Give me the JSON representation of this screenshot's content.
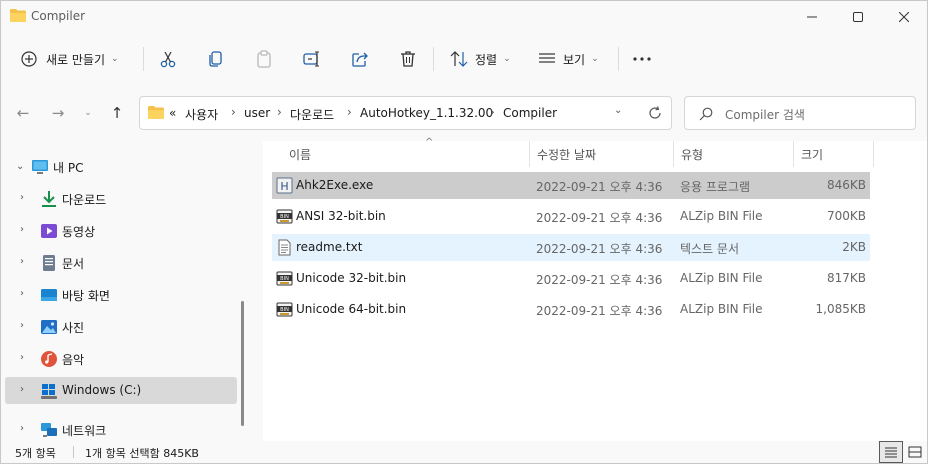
{
  "window": {
    "title": "Compiler",
    "controls": [
      "minimize",
      "maximize",
      "close"
    ]
  },
  "toolbar": {
    "new_label": "새로 만들기",
    "sort_label": "정렬",
    "view_label": "보기",
    "icons": [
      "cut-icon",
      "copy-icon",
      "paste-icon",
      "rename-icon",
      "share-icon",
      "delete-icon"
    ]
  },
  "address": {
    "overflow": "«",
    "crumbs": [
      "사용자",
      "user",
      "다운로드",
      "AutoHotkey_1.1.32.00",
      "Compiler"
    ]
  },
  "search": {
    "placeholder": "Compiler 검색"
  },
  "sidebar": {
    "items": [
      {
        "label": "내 PC",
        "icon": "pc-icon",
        "expanded": true
      },
      {
        "label": "다운로드",
        "icon": "download-icon"
      },
      {
        "label": "동영상",
        "icon": "video-icon"
      },
      {
        "label": "문서",
        "icon": "document-icon"
      },
      {
        "label": "바탕 화면",
        "icon": "desktop-icon"
      },
      {
        "label": "사진",
        "icon": "pictures-icon"
      },
      {
        "label": "음악",
        "icon": "music-icon"
      },
      {
        "label": "Windows (C:)",
        "icon": "drive-icon",
        "selected": true
      },
      {
        "label": "네트워크",
        "icon": "network-icon"
      }
    ]
  },
  "columns": {
    "name": "이름",
    "date": "수정한 날짜",
    "type": "유형",
    "size": "크기"
  },
  "files": [
    {
      "name": "Ahk2Exe.exe",
      "date": "2022-09-21 오후 4:36",
      "type": "응용 프로그램",
      "size": "846KB",
      "icon": "exe-icon",
      "state": "selected"
    },
    {
      "name": "ANSI 32-bit.bin",
      "date": "2022-09-21 오후 4:36",
      "type": "ALZip BIN File",
      "size": "700KB",
      "icon": "bin-icon",
      "state": ""
    },
    {
      "name": "readme.txt",
      "date": "2022-09-21 오후 4:36",
      "type": "텍스트 문서",
      "size": "2KB",
      "icon": "txt-icon",
      "state": "hover"
    },
    {
      "name": "Unicode 32-bit.bin",
      "date": "2022-09-21 오후 4:36",
      "type": "ALZip BIN File",
      "size": "817KB",
      "icon": "bin-icon",
      "state": ""
    },
    {
      "name": "Unicode 64-bit.bin",
      "date": "2022-09-21 오후 4:36",
      "type": "ALZip BIN File",
      "size": "1,085KB",
      "icon": "bin-icon",
      "state": ""
    }
  ],
  "status": {
    "count": "5개 항목",
    "selection": "1개 항목 선택함 845KB"
  }
}
